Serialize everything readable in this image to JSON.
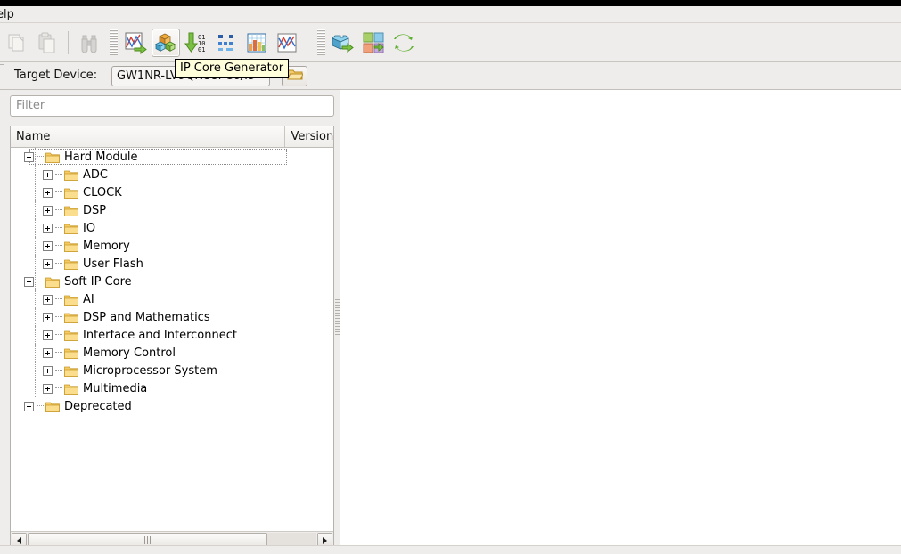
{
  "menubar": {
    "items": [
      {
        "label": "elp",
        "name": "menu-help"
      }
    ]
  },
  "toolbar": {
    "groups": [
      {
        "name": "clipboard-group",
        "buttons": [
          {
            "name": "copy-button",
            "icon": "copy-icon",
            "label": "Copy",
            "state": "disabled"
          },
          {
            "name": "paste-button",
            "icon": "paste-icon",
            "label": "Paste",
            "state": "disabled"
          }
        ]
      },
      {
        "name": "search-group",
        "buttons": [
          {
            "name": "find-button",
            "icon": "binoculars-icon",
            "label": "Find",
            "state": "normal"
          }
        ]
      },
      {
        "name": "tools-group",
        "buttons": [
          {
            "name": "floorplanner-button",
            "icon": "chart-arrow-icon",
            "label": "FloorPlanner",
            "state": "normal"
          },
          {
            "name": "ip-core-generator-button",
            "icon": "blocks-icon",
            "label": "IP Core Generator",
            "state": "active"
          },
          {
            "name": "programmer-button",
            "icon": "download-binary-icon",
            "label": "Programmer",
            "state": "normal"
          },
          {
            "name": "gao-button",
            "icon": "waveform-dots-icon",
            "label": "GAO",
            "state": "normal"
          },
          {
            "name": "schematic-button",
            "icon": "grid-table-icon",
            "label": "Schematic Viewer",
            "state": "normal"
          },
          {
            "name": "timing-button",
            "icon": "timing-chart-icon",
            "label": "Timing Analyzer",
            "state": "normal"
          }
        ]
      },
      {
        "name": "flow-group",
        "buttons": [
          {
            "name": "synthesize-button",
            "icon": "block-arrow-icon",
            "label": "Synthesize",
            "state": "normal"
          },
          {
            "name": "place-route-button",
            "icon": "tiles-arrow-icon",
            "label": "Place & Route",
            "state": "normal"
          },
          {
            "name": "rerun-all-button",
            "icon": "refresh-icon",
            "label": "Rerun All",
            "state": "normal"
          }
        ]
      }
    ]
  },
  "tooltip": {
    "text": "IP Core Generator",
    "background": "#ffffdc",
    "border": "#000000"
  },
  "device_bar": {
    "label": "Target Device:",
    "value": "GW1NR-LV9QN88PC6/I5",
    "placeholder": "",
    "browse_icon": "folder-open-icon"
  },
  "left_panel": {
    "filter": {
      "value": "",
      "placeholder": "Filter"
    },
    "tree": {
      "columns": [
        {
          "key": "name",
          "label": "Name"
        },
        {
          "key": "version",
          "label": "Version"
        }
      ],
      "rows": [
        {
          "label": "Hard Module",
          "depth": 0,
          "expander": "minus",
          "focused": true,
          "version": ""
        },
        {
          "label": "ADC",
          "depth": 1,
          "expander": "plus",
          "focused": false,
          "version": ""
        },
        {
          "label": "CLOCK",
          "depth": 1,
          "expander": "plus",
          "focused": false,
          "version": ""
        },
        {
          "label": "DSP",
          "depth": 1,
          "expander": "plus",
          "focused": false,
          "version": ""
        },
        {
          "label": "IO",
          "depth": 1,
          "expander": "plus",
          "focused": false,
          "version": ""
        },
        {
          "label": "Memory",
          "depth": 1,
          "expander": "plus",
          "focused": false,
          "version": ""
        },
        {
          "label": "User Flash",
          "depth": 1,
          "expander": "plus",
          "focused": false,
          "version": ""
        },
        {
          "label": "Soft IP Core",
          "depth": 0,
          "expander": "minus",
          "focused": false,
          "version": ""
        },
        {
          "label": "AI",
          "depth": 1,
          "expander": "plus",
          "focused": false,
          "version": ""
        },
        {
          "label": "DSP and Mathematics",
          "depth": 1,
          "expander": "plus",
          "focused": false,
          "version": ""
        },
        {
          "label": "Interface and Interconnect",
          "depth": 1,
          "expander": "plus",
          "focused": false,
          "version": ""
        },
        {
          "label": "Memory Control",
          "depth": 1,
          "expander": "plus",
          "focused": false,
          "version": ""
        },
        {
          "label": "Microprocessor System",
          "depth": 1,
          "expander": "plus",
          "focused": false,
          "version": ""
        },
        {
          "label": "Multimedia",
          "depth": 1,
          "expander": "plus",
          "focused": false,
          "version": ""
        },
        {
          "label": "Deprecated",
          "depth": 0,
          "expander": "plus",
          "focused": false,
          "version": ""
        }
      ]
    },
    "hscrollbar": {
      "left_arrow": "scroll-left-icon",
      "right_arrow": "scroll-right-icon",
      "thumb_fraction": 0.83
    }
  },
  "colors": {
    "chrome": "#efedeb",
    "panel": "#ffffff",
    "folder": "#f5c95a",
    "accent_green": "#6aa82e"
  }
}
